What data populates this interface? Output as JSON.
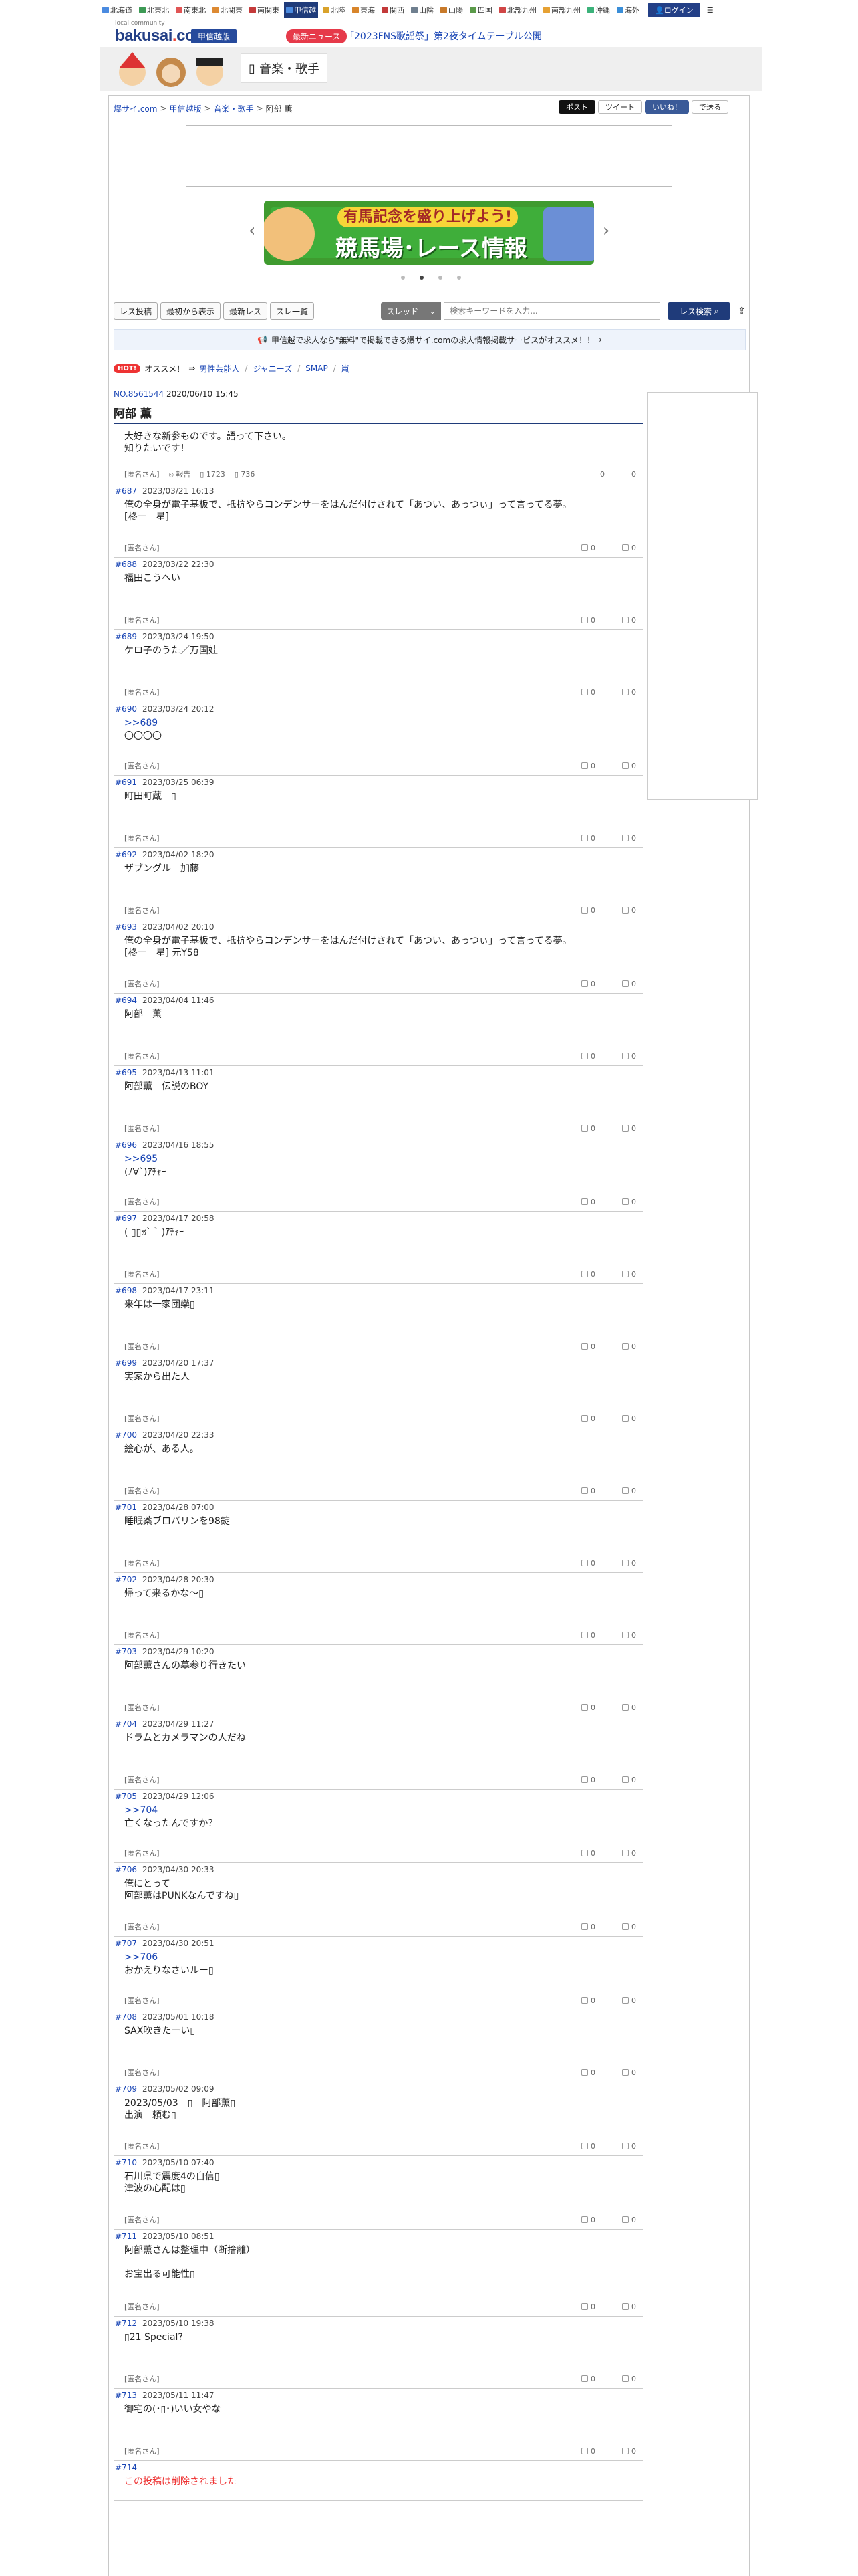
{
  "regions": [
    {
      "label": "北海道",
      "color": "#4b8be0"
    },
    {
      "label": "北東北",
      "color": "#3d9a55"
    },
    {
      "label": "南東北",
      "color": "#e05555"
    },
    {
      "label": "北関東",
      "color": "#dd8a33"
    },
    {
      "label": "南関東",
      "color": "#c43a3a"
    },
    {
      "label": "甲信越",
      "color": "#4b8be0",
      "active": true
    },
    {
      "label": "北陸",
      "color": "#d9a22b"
    },
    {
      "label": "東海",
      "color": "#d8852a"
    },
    {
      "label": "関西",
      "color": "#c33939"
    },
    {
      "label": "山陰",
      "color": "#6f7f8f"
    },
    {
      "label": "山陽",
      "color": "#c87a2a"
    },
    {
      "label": "四国",
      "color": "#5b9b4a"
    },
    {
      "label": "北部九州",
      "color": "#d04545"
    },
    {
      "label": "南部九州",
      "color": "#e6a133"
    },
    {
      "label": "沖縄",
      "color": "#3bb27a"
    },
    {
      "label": "海外",
      "color": "#3a8ed8"
    }
  ],
  "login_label": "ログイン",
  "logo": {
    "sub": "local community",
    "name": "bakusai",
    "dot": ".",
    "tld": "com"
  },
  "area_chip": "甲信越版",
  "news_chip": "最新ニュース",
  "news_text": "「2023FNS歌謡祭」第2夜タイムテーブル公開",
  "category": "音楽・歌手",
  "breadcrumb": [
    "爆サイ.com",
    "甲信越版",
    "音楽・歌手",
    "阿部 薫"
  ],
  "share": {
    "x": "ポスト",
    "tweet": "ツイート",
    "like": "いいね！",
    "line": "で送る"
  },
  "banner": {
    "top": "有馬記念を盛り上げよう!",
    "big": "競馬場･レース情報"
  },
  "toolbar": {
    "b1": "レス投稿",
    "b2": "最初から表示",
    "b3": "最新レス",
    "b4": "スレ一覧",
    "select": "スレッド",
    "placeholder": "検索キーワードを入力...",
    "search": "レス検索"
  },
  "promo": "甲信越で求人なら\"無料\"で掲載できる爆サイ.comの求人情報掲載サービスがオススメ！！",
  "hot": {
    "badge": "HOT!",
    "label": "オススメ！",
    "links": [
      "男性芸能人",
      "ジャニーズ",
      "SMAP",
      "嵐"
    ]
  },
  "thread": {
    "no": "NO.8561544",
    "date": "2020/06/10 15:45",
    "title": "阿部 薫",
    "body": "大好きな新参ものです。語って下さい。\n知りたいです！",
    "author": "[匿名さん]",
    "report": "報告",
    "views": "1723",
    "replies": "736"
  },
  "posts": [
    {
      "num": "#687",
      "date": "2023/03/21 16:13",
      "body": "俺の全身が電子基板で、抵抗やらコンデンサーをはんだ付けされて「あつい、あっつぃ」って言ってる夢。\n[柊一　星]"
    },
    {
      "num": "#688",
      "date": "2023/03/22 22:30",
      "body": "福田こうへい"
    },
    {
      "num": "#689",
      "date": "2023/03/24 19:50",
      "body": "ケロ子のうた／万国娃"
    },
    {
      "num": "#690",
      "date": "2023/03/24 20:12",
      "anchor": ">>689",
      "body": "〇〇〇〇"
    },
    {
      "num": "#691",
      "date": "2023/03/25 06:39",
      "body": "町田町蔵　▯"
    },
    {
      "num": "#692",
      "date": "2023/04/02 18:20",
      "body": "ザブングル　加藤"
    },
    {
      "num": "#693",
      "date": "2023/04/02 20:10",
      "body": "俺の全身が電子基板で、抵抗やらコンデンサーをはんだ付けされて「あつい、あっつぃ」って言ってる夢。\n[柊一　星] 元Y58"
    },
    {
      "num": "#694",
      "date": "2023/04/04 11:46",
      "body": "阿部　薫"
    },
    {
      "num": "#695",
      "date": "2023/04/13 11:01",
      "body": "阿部薫　伝説のBOY"
    },
    {
      "num": "#696",
      "date": "2023/04/16 18:55",
      "anchor": ">>695",
      "body": "(ﾉ∀`)ｱﾁｬｰ"
    },
    {
      "num": "#697",
      "date": "2023/04/17 20:58",
      "body": "( ▯▯ಠ` ` )ｱﾁｬｰ"
    },
    {
      "num": "#698",
      "date": "2023/04/17 23:11",
      "body": "来年は一家団欒▯"
    },
    {
      "num": "#699",
      "date": "2023/04/20 17:37",
      "body": "実家から出た人"
    },
    {
      "num": "#700",
      "date": "2023/04/20 22:33",
      "body": "絵心が、ある人。"
    },
    {
      "num": "#701",
      "date": "2023/04/28 07:00",
      "body": "睡眠薬ブロバリンを98錠"
    },
    {
      "num": "#702",
      "date": "2023/04/28 20:30",
      "body": "帰って来るかな〜▯"
    },
    {
      "num": "#703",
      "date": "2023/04/29 10:20",
      "body": "阿部薫さんの墓参り行きたい"
    },
    {
      "num": "#704",
      "date": "2023/04/29 11:27",
      "body": "ドラムとカメラマンの人だね"
    },
    {
      "num": "#705",
      "date": "2023/04/29 12:06",
      "anchor": ">>704",
      "body": "亡くなったんですか？"
    },
    {
      "num": "#706",
      "date": "2023/04/30 20:33",
      "body": "俺にとって\n阿部薫はPUNKなんですね▯"
    },
    {
      "num": "#707",
      "date": "2023/04/30 20:51",
      "anchor": ">>706",
      "body": "おかえりなさいルー▯"
    },
    {
      "num": "#708",
      "date": "2023/05/01 10:18",
      "body": "SAX吹きたーい▯"
    },
    {
      "num": "#709",
      "date": "2023/05/02 09:09",
      "body": "2023/05/03　▯　阿部薫▯\n出演　頼む▯"
    },
    {
      "num": "#710",
      "date": "2023/05/10 07:40",
      "body": "石川県で震度4の自信▯\n津波の心配は▯"
    },
    {
      "num": "#711",
      "date": "2023/05/10 08:51",
      "body": "阿部薫さんは整理中（断捨離）\n\nお宝出る可能性▯"
    },
    {
      "num": "#712",
      "date": "2023/05/10 19:38",
      "body": "▯21 Special?"
    },
    {
      "num": "#713",
      "date": "2023/05/11 11:47",
      "body": "御宅の(･▯･)いい女やな"
    },
    {
      "num": "#714",
      "date": "",
      "body": "この投稿は削除されました",
      "deleted": true
    }
  ],
  "post_author": "[匿名さん]",
  "vote_up": "0",
  "vote_down": "0"
}
